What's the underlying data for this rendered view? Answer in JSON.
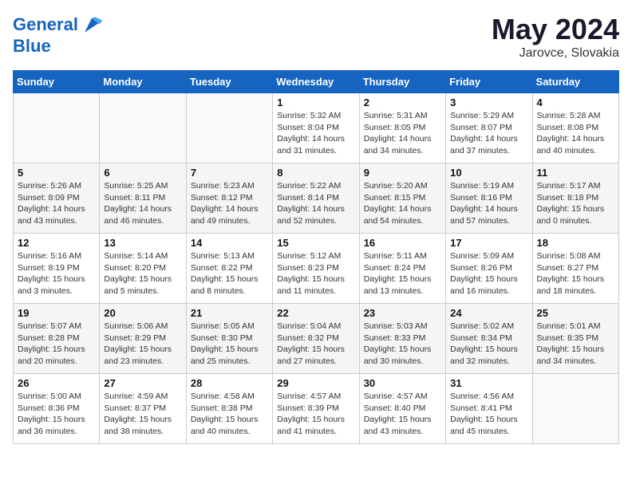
{
  "header": {
    "logo_line1": "General",
    "logo_line2": "Blue",
    "main_title": "May 2024",
    "subtitle": "Jarovce, Slovakia"
  },
  "weekdays": [
    "Sunday",
    "Monday",
    "Tuesday",
    "Wednesday",
    "Thursday",
    "Friday",
    "Saturday"
  ],
  "weeks": [
    [
      {
        "day": "",
        "info": ""
      },
      {
        "day": "",
        "info": ""
      },
      {
        "day": "",
        "info": ""
      },
      {
        "day": "1",
        "info": "Sunrise: 5:32 AM\nSunset: 8:04 PM\nDaylight: 14 hours\nand 31 minutes."
      },
      {
        "day": "2",
        "info": "Sunrise: 5:31 AM\nSunset: 8:05 PM\nDaylight: 14 hours\nand 34 minutes."
      },
      {
        "day": "3",
        "info": "Sunrise: 5:29 AM\nSunset: 8:07 PM\nDaylight: 14 hours\nand 37 minutes."
      },
      {
        "day": "4",
        "info": "Sunrise: 5:28 AM\nSunset: 8:08 PM\nDaylight: 14 hours\nand 40 minutes."
      }
    ],
    [
      {
        "day": "5",
        "info": "Sunrise: 5:26 AM\nSunset: 8:09 PM\nDaylight: 14 hours\nand 43 minutes."
      },
      {
        "day": "6",
        "info": "Sunrise: 5:25 AM\nSunset: 8:11 PM\nDaylight: 14 hours\nand 46 minutes."
      },
      {
        "day": "7",
        "info": "Sunrise: 5:23 AM\nSunset: 8:12 PM\nDaylight: 14 hours\nand 49 minutes."
      },
      {
        "day": "8",
        "info": "Sunrise: 5:22 AM\nSunset: 8:14 PM\nDaylight: 14 hours\nand 52 minutes."
      },
      {
        "day": "9",
        "info": "Sunrise: 5:20 AM\nSunset: 8:15 PM\nDaylight: 14 hours\nand 54 minutes."
      },
      {
        "day": "10",
        "info": "Sunrise: 5:19 AM\nSunset: 8:16 PM\nDaylight: 14 hours\nand 57 minutes."
      },
      {
        "day": "11",
        "info": "Sunrise: 5:17 AM\nSunset: 8:18 PM\nDaylight: 15 hours\nand 0 minutes."
      }
    ],
    [
      {
        "day": "12",
        "info": "Sunrise: 5:16 AM\nSunset: 8:19 PM\nDaylight: 15 hours\nand 3 minutes."
      },
      {
        "day": "13",
        "info": "Sunrise: 5:14 AM\nSunset: 8:20 PM\nDaylight: 15 hours\nand 5 minutes."
      },
      {
        "day": "14",
        "info": "Sunrise: 5:13 AM\nSunset: 8:22 PM\nDaylight: 15 hours\nand 8 minutes."
      },
      {
        "day": "15",
        "info": "Sunrise: 5:12 AM\nSunset: 8:23 PM\nDaylight: 15 hours\nand 11 minutes."
      },
      {
        "day": "16",
        "info": "Sunrise: 5:11 AM\nSunset: 8:24 PM\nDaylight: 15 hours\nand 13 minutes."
      },
      {
        "day": "17",
        "info": "Sunrise: 5:09 AM\nSunset: 8:26 PM\nDaylight: 15 hours\nand 16 minutes."
      },
      {
        "day": "18",
        "info": "Sunrise: 5:08 AM\nSunset: 8:27 PM\nDaylight: 15 hours\nand 18 minutes."
      }
    ],
    [
      {
        "day": "19",
        "info": "Sunrise: 5:07 AM\nSunset: 8:28 PM\nDaylight: 15 hours\nand 20 minutes."
      },
      {
        "day": "20",
        "info": "Sunrise: 5:06 AM\nSunset: 8:29 PM\nDaylight: 15 hours\nand 23 minutes."
      },
      {
        "day": "21",
        "info": "Sunrise: 5:05 AM\nSunset: 8:30 PM\nDaylight: 15 hours\nand 25 minutes."
      },
      {
        "day": "22",
        "info": "Sunrise: 5:04 AM\nSunset: 8:32 PM\nDaylight: 15 hours\nand 27 minutes."
      },
      {
        "day": "23",
        "info": "Sunrise: 5:03 AM\nSunset: 8:33 PM\nDaylight: 15 hours\nand 30 minutes."
      },
      {
        "day": "24",
        "info": "Sunrise: 5:02 AM\nSunset: 8:34 PM\nDaylight: 15 hours\nand 32 minutes."
      },
      {
        "day": "25",
        "info": "Sunrise: 5:01 AM\nSunset: 8:35 PM\nDaylight: 15 hours\nand 34 minutes."
      }
    ],
    [
      {
        "day": "26",
        "info": "Sunrise: 5:00 AM\nSunset: 8:36 PM\nDaylight: 15 hours\nand 36 minutes."
      },
      {
        "day": "27",
        "info": "Sunrise: 4:59 AM\nSunset: 8:37 PM\nDaylight: 15 hours\nand 38 minutes."
      },
      {
        "day": "28",
        "info": "Sunrise: 4:58 AM\nSunset: 8:38 PM\nDaylight: 15 hours\nand 40 minutes."
      },
      {
        "day": "29",
        "info": "Sunrise: 4:57 AM\nSunset: 8:39 PM\nDaylight: 15 hours\nand 41 minutes."
      },
      {
        "day": "30",
        "info": "Sunrise: 4:57 AM\nSunset: 8:40 PM\nDaylight: 15 hours\nand 43 minutes."
      },
      {
        "day": "31",
        "info": "Sunrise: 4:56 AM\nSunset: 8:41 PM\nDaylight: 15 hours\nand 45 minutes."
      },
      {
        "day": "",
        "info": ""
      }
    ]
  ]
}
